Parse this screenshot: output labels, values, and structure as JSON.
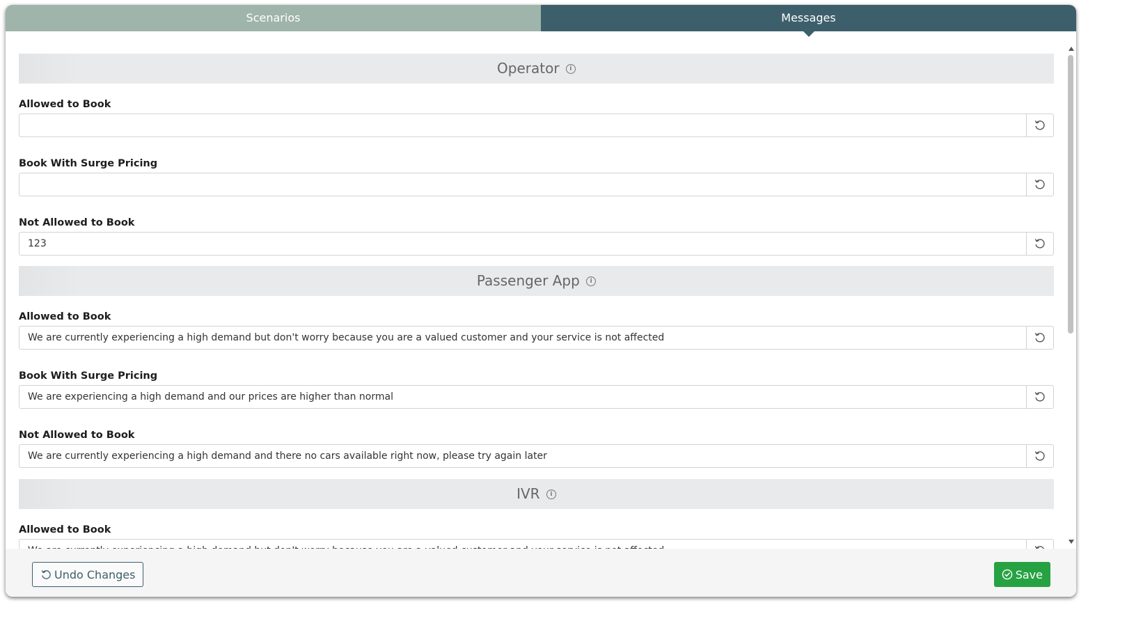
{
  "tabs": [
    {
      "label": "Scenarios",
      "active": false
    },
    {
      "label": "Messages",
      "active": true
    }
  ],
  "sections": [
    {
      "title": "Operator",
      "fields": [
        {
          "label": "Allowed to Book",
          "value": ""
        },
        {
          "label": "Book With Surge Pricing",
          "value": ""
        },
        {
          "label": "Not Allowed to Book",
          "value": "123"
        }
      ]
    },
    {
      "title": "Passenger App",
      "fields": [
        {
          "label": "Allowed to Book",
          "value": "We are currently experiencing a high demand but don't worry because you are a valued customer and your service is not affected"
        },
        {
          "label": "Book With Surge Pricing",
          "value": "We are experiencing a high demand and our prices are higher than normal"
        },
        {
          "label": "Not Allowed to Book",
          "value": "We are currently experiencing a high demand and there no cars available right now, please try again later"
        }
      ]
    },
    {
      "title": "IVR",
      "fields": [
        {
          "label": "Allowed to Book",
          "value": "We are currently experiencing a high demand but don't worry because you are a valued customer and your service is not affected"
        }
      ]
    }
  ],
  "icons": {
    "info": "info-icon",
    "reset": "reset-icon",
    "undo": "undo-icon",
    "save": "check-circle-icon"
  },
  "info_glyph": "i",
  "footer": {
    "undo_label": "Undo Changes",
    "save_label": "Save"
  },
  "colors": {
    "tab_inactive": "#9fb4ab",
    "tab_active": "#3d5f6c",
    "save_button": "#27a243",
    "section_header": "#e9eaec"
  }
}
